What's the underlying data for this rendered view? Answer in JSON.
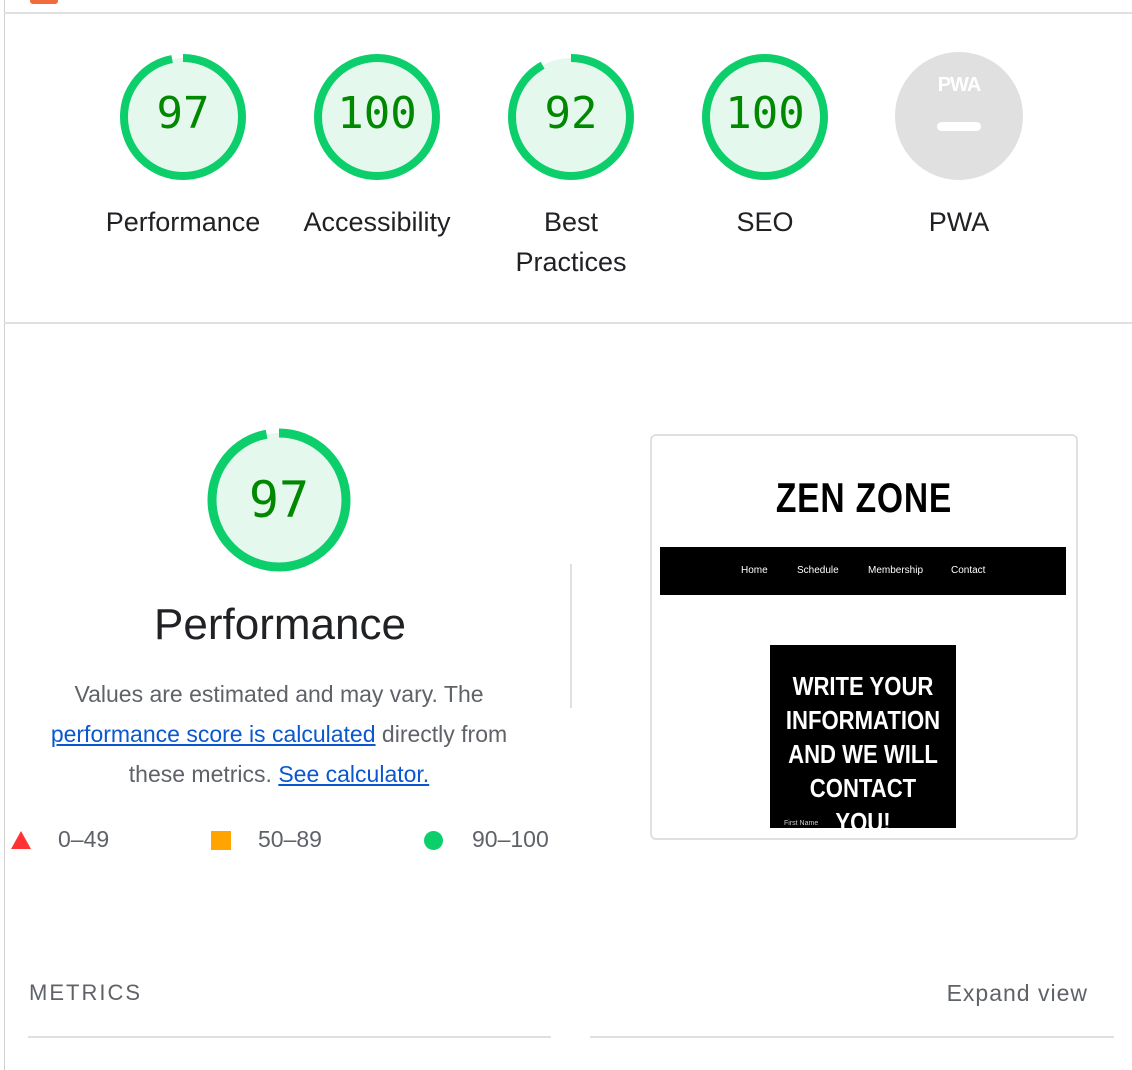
{
  "colors": {
    "pass": "#0cce6b",
    "pass_text": "#008800",
    "pass_fill": "#e5f8ee",
    "average": "#ffa400",
    "fail": "#ff3333",
    "na": "#e0e0e0"
  },
  "scores": [
    {
      "value": "97",
      "label": "Performance",
      "fraction": 0.97
    },
    {
      "value": "100",
      "label": "Accessibility",
      "fraction": 1.0
    },
    {
      "value": "92",
      "label": "Best Practices",
      "fraction": 0.92
    },
    {
      "value": "100",
      "label": "SEO",
      "fraction": 1.0
    },
    {
      "value": "",
      "label": "PWA",
      "badge": "PWA"
    }
  ],
  "performance": {
    "score": "97",
    "fraction": 0.97,
    "title": "Performance",
    "desc_before": "Values are estimated and may vary. The ",
    "desc_link1": "performance score is calculated",
    "desc_middle": " directly from these metrics. ",
    "desc_link2": "See calculator."
  },
  "legend": [
    {
      "shape": "triangle-icon",
      "range": "0–49"
    },
    {
      "shape": "square-icon",
      "range": "50–89"
    },
    {
      "shape": "circle-icon",
      "range": "90–100"
    }
  ],
  "screenshot": {
    "site_title": "ZEN ZONE",
    "nav": [
      "Home",
      "Schedule",
      "Membership",
      "Contact"
    ],
    "promo": "WRITE YOUR INFORMATION AND WE WILL CONTACT YOU!",
    "field_label": "First Name"
  },
  "metrics": {
    "title": "METRICS",
    "expand": "Expand view"
  }
}
